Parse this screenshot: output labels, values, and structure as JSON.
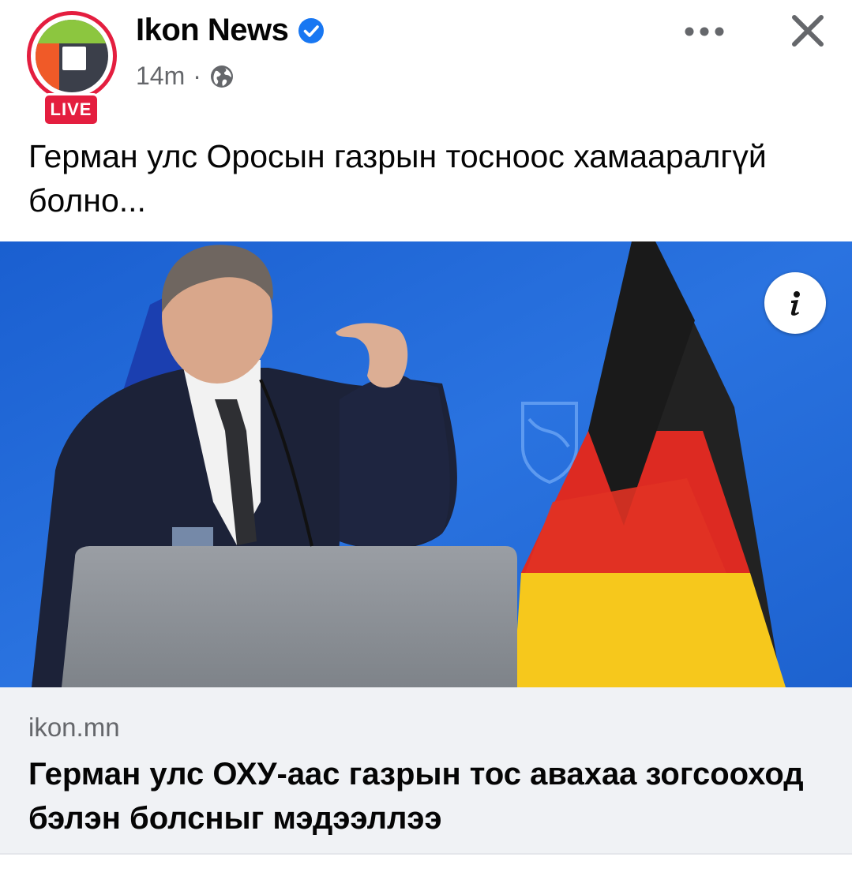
{
  "header": {
    "page_name": "Ikon News",
    "live_badge": "LIVE",
    "timestamp": "14m",
    "separator": "·",
    "verified_icon": "verified-badge-icon",
    "audience_icon": "globe-icon",
    "more_icon": "more-horizontal-icon",
    "close_icon": "close-icon"
  },
  "post": {
    "caption": "Герман улс Оросын газрын тосноос хамааралгүй болно...",
    "info_icon": "info-icon"
  },
  "link_preview": {
    "domain": "ikon.mn",
    "title": "Герман улс ОХУ-аас газрын тос авахаа зогсооход бэлэн болсныг мэдээллээ"
  },
  "colors": {
    "live_red": "#e41e3f",
    "verified_blue": "#1877f2",
    "secondary_text": "#65676b",
    "preview_bg": "#f0f2f5",
    "photo_backdrop_blue": "#1f67d6"
  }
}
